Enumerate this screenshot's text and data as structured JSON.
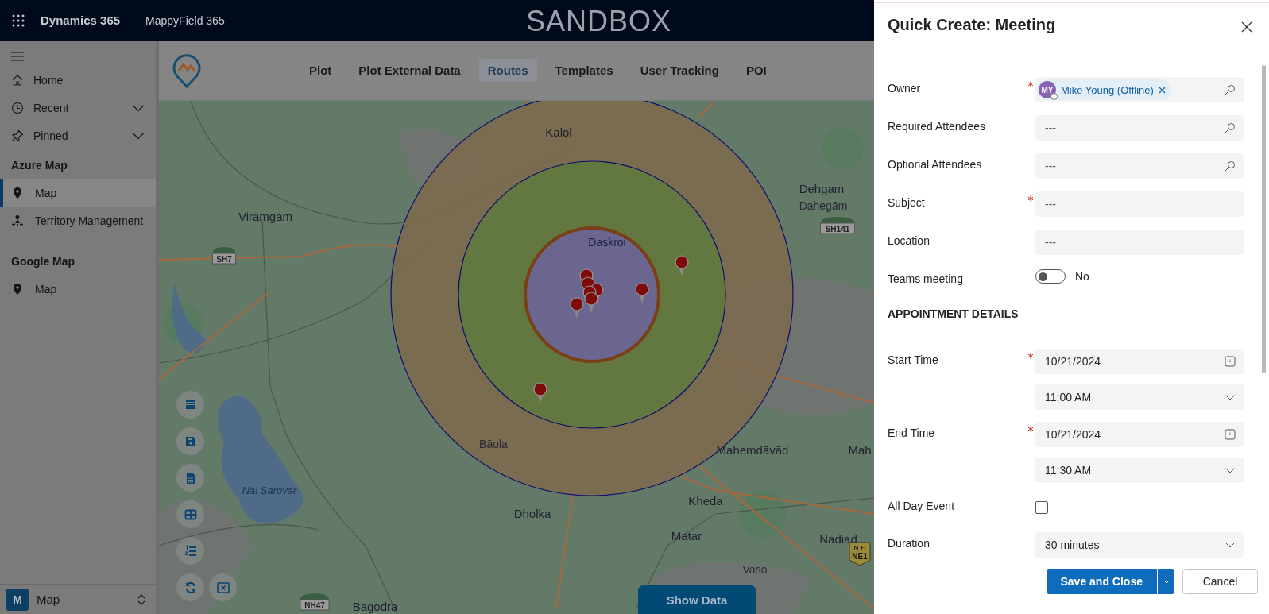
{
  "top_bar": {
    "app_name": "Dynamics 365",
    "module": "MappyField 365",
    "environment": "SANDBOX"
  },
  "sidebar": {
    "nav_items": [
      {
        "label": "Home",
        "expandable": false
      },
      {
        "label": "Recent",
        "expandable": true
      },
      {
        "label": "Pinned",
        "expandable": true
      }
    ],
    "groups": [
      {
        "title": "Azure Map",
        "items": [
          {
            "label": "Map",
            "selected": true
          },
          {
            "label": "Territory Management",
            "selected": false
          }
        ]
      },
      {
        "title": "Google Map",
        "items": [
          {
            "label": "Map",
            "selected": false
          }
        ]
      }
    ],
    "area_switcher": {
      "badge": "M",
      "label": "Map"
    }
  },
  "map_nav": {
    "tabs": [
      {
        "label": "Plot",
        "selected": false
      },
      {
        "label": "Plot External Data",
        "selected": false
      },
      {
        "label": "Routes",
        "selected": true
      },
      {
        "label": "Templates",
        "selected": false
      },
      {
        "label": "User Tracking",
        "selected": false
      },
      {
        "label": "POI",
        "selected": false
      }
    ]
  },
  "map": {
    "labels": [
      {
        "text": "Kalol",
        "kind": "city"
      },
      {
        "text": "Viramgam",
        "kind": "city"
      },
      {
        "text": "Dehgam",
        "kind": "city"
      },
      {
        "text": "Dahegām",
        "kind": "town"
      },
      {
        "text": "Daskroi",
        "kind": "faint"
      },
      {
        "text": "Bāola",
        "kind": "town"
      },
      {
        "text": "Mahemdāvād",
        "kind": "city"
      },
      {
        "text": "Mah",
        "kind": "city"
      },
      {
        "text": "Dholka",
        "kind": "city"
      },
      {
        "text": "Kheda",
        "kind": "city"
      },
      {
        "text": "Matar",
        "kind": "city"
      },
      {
        "text": "Nadiad",
        "kind": "city"
      },
      {
        "text": "Vaso",
        "kind": "town"
      },
      {
        "text": "Bagodra",
        "kind": "city"
      },
      {
        "text": "Nal Sarovar",
        "kind": "water"
      }
    ],
    "shields": [
      {
        "text": "SH7",
        "kind": "state"
      },
      {
        "text": "SH141",
        "kind": "state"
      },
      {
        "text": "NH47",
        "kind": "state"
      },
      {
        "text": "NE1",
        "top_text": "N H",
        "kind": "national"
      }
    ],
    "show_data_button": "Show Data"
  },
  "quick_create": {
    "title": "Quick Create: Meeting",
    "fields": [
      {
        "kind": "lookup",
        "label": "Owner",
        "required": true,
        "value": {
          "initials": "MY",
          "name": "Mike Young (Offline)"
        }
      },
      {
        "kind": "lookup",
        "label": "Required Attendees",
        "required": false,
        "placeholder": "---"
      },
      {
        "kind": "lookup",
        "label": "Optional Attendees",
        "required": false,
        "placeholder": "---"
      },
      {
        "kind": "text",
        "label": "Subject",
        "required": true,
        "placeholder": "---"
      },
      {
        "kind": "text",
        "label": "Location",
        "required": false,
        "placeholder": "---"
      },
      {
        "kind": "toggle",
        "label": "Teams meeting",
        "on": false,
        "value": "No"
      },
      {
        "kind": "section",
        "label": "APPOINTMENT DETAILS"
      },
      {
        "kind": "date",
        "label": "Start Time",
        "required": true,
        "value": "10/21/2024"
      },
      {
        "kind": "select",
        "value": "11:00 AM"
      },
      {
        "kind": "date",
        "label": "End Time",
        "required": true,
        "value": "10/21/2024"
      },
      {
        "kind": "select",
        "value": "11:30 AM"
      },
      {
        "kind": "checkbox",
        "label": "All Day Event",
        "checked": false
      },
      {
        "kind": "select",
        "label": "Duration",
        "value": "30 minutes"
      }
    ],
    "buttons": {
      "primary": "Save and Close",
      "secondary": "Cancel"
    }
  }
}
